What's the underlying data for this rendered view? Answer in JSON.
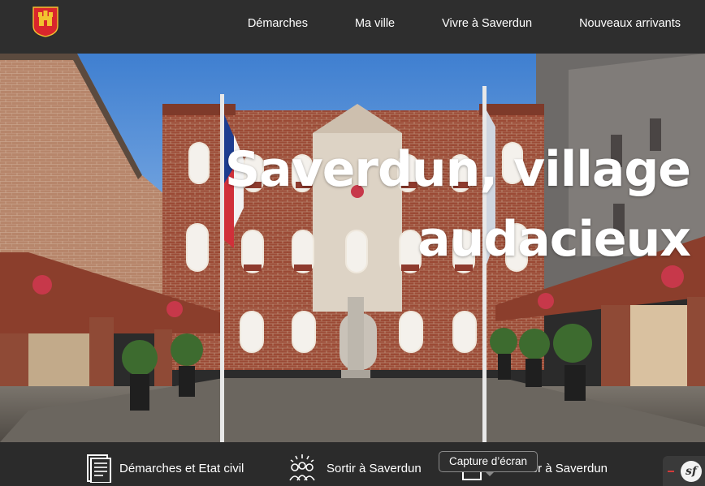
{
  "header": {
    "logo_name": "saverdun-coat-of-arms",
    "nav": [
      "Démarches",
      "Ma ville",
      "Vivre à Saverdun",
      "Nouveaux arrivants"
    ]
  },
  "hero": {
    "title_line1": "Saverdun, village",
    "title_line2": "audacieux"
  },
  "quick_links": [
    {
      "label": "Démarches et Etat civil",
      "icon": "document-icon"
    },
    {
      "label": "Sortir à Saverdun",
      "icon": "people-celebrate-icon"
    },
    {
      "label": "Travailler à Saverdun",
      "icon": "briefcase-icon"
    }
  ],
  "tooltip": "Capture d’écran",
  "cookie_badge": "sf",
  "colors": {
    "header_bg": "#2e2e2e",
    "bar_bg": "#2b2b2b",
    "brick": "#9b4a35",
    "sky": "#5a8fd6",
    "logo_red": "#d9262c",
    "logo_gold": "#f2c230"
  }
}
